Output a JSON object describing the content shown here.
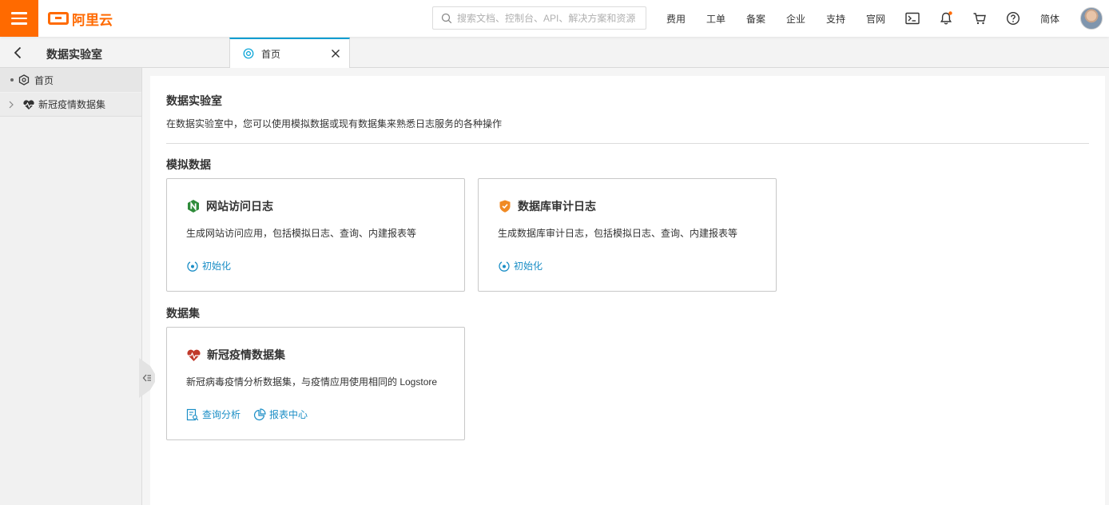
{
  "topbar": {
    "logo_text": "阿里云",
    "search_placeholder": "搜索文档、控制台、API、解决方案和资源",
    "nav": [
      "费用",
      "工单",
      "备案",
      "企业",
      "支持",
      "官网"
    ],
    "language": "简体"
  },
  "subbar": {
    "title": "数据实验室",
    "tab_label": "首页"
  },
  "sidebar": {
    "items": [
      {
        "label": "首页",
        "icon": "hexagon-icon"
      },
      {
        "label": "新冠疫情数据集",
        "icon": "heartbeat-icon"
      }
    ]
  },
  "main": {
    "title": "数据实验室",
    "description": "在数据实验室中，您可以使用模拟数据或现有数据集来熟悉日志服务的各种操作",
    "sections": {
      "simulated": {
        "title": "模拟数据",
        "cards": [
          {
            "title": "网站访问日志",
            "description": "生成网站访问应用，包括模拟日志、查询、内建报表等",
            "action": "初始化",
            "icon": "nginx-icon"
          },
          {
            "title": "数据库审计日志",
            "description": "生成数据库审计日志，包括模拟日志、查询、内建报表等",
            "action": "初始化",
            "icon": "shield-icon"
          }
        ]
      },
      "datasets": {
        "title": "数据集",
        "cards": [
          {
            "title": "新冠疫情数据集",
            "description": "新冠病毒疫情分析数据集，与疫情应用使用相同的 Logstore",
            "actions": [
              "查询分析",
              "报表中心"
            ],
            "icon": "heartbeat-icon"
          }
        ]
      }
    }
  },
  "colors": {
    "brand": "#ff6a00",
    "link": "#1b8ec6",
    "tab_accent": "#00a1d6",
    "nginx": "#2e8b3a",
    "shield": "#f08a24",
    "heart": "#c0392b"
  }
}
